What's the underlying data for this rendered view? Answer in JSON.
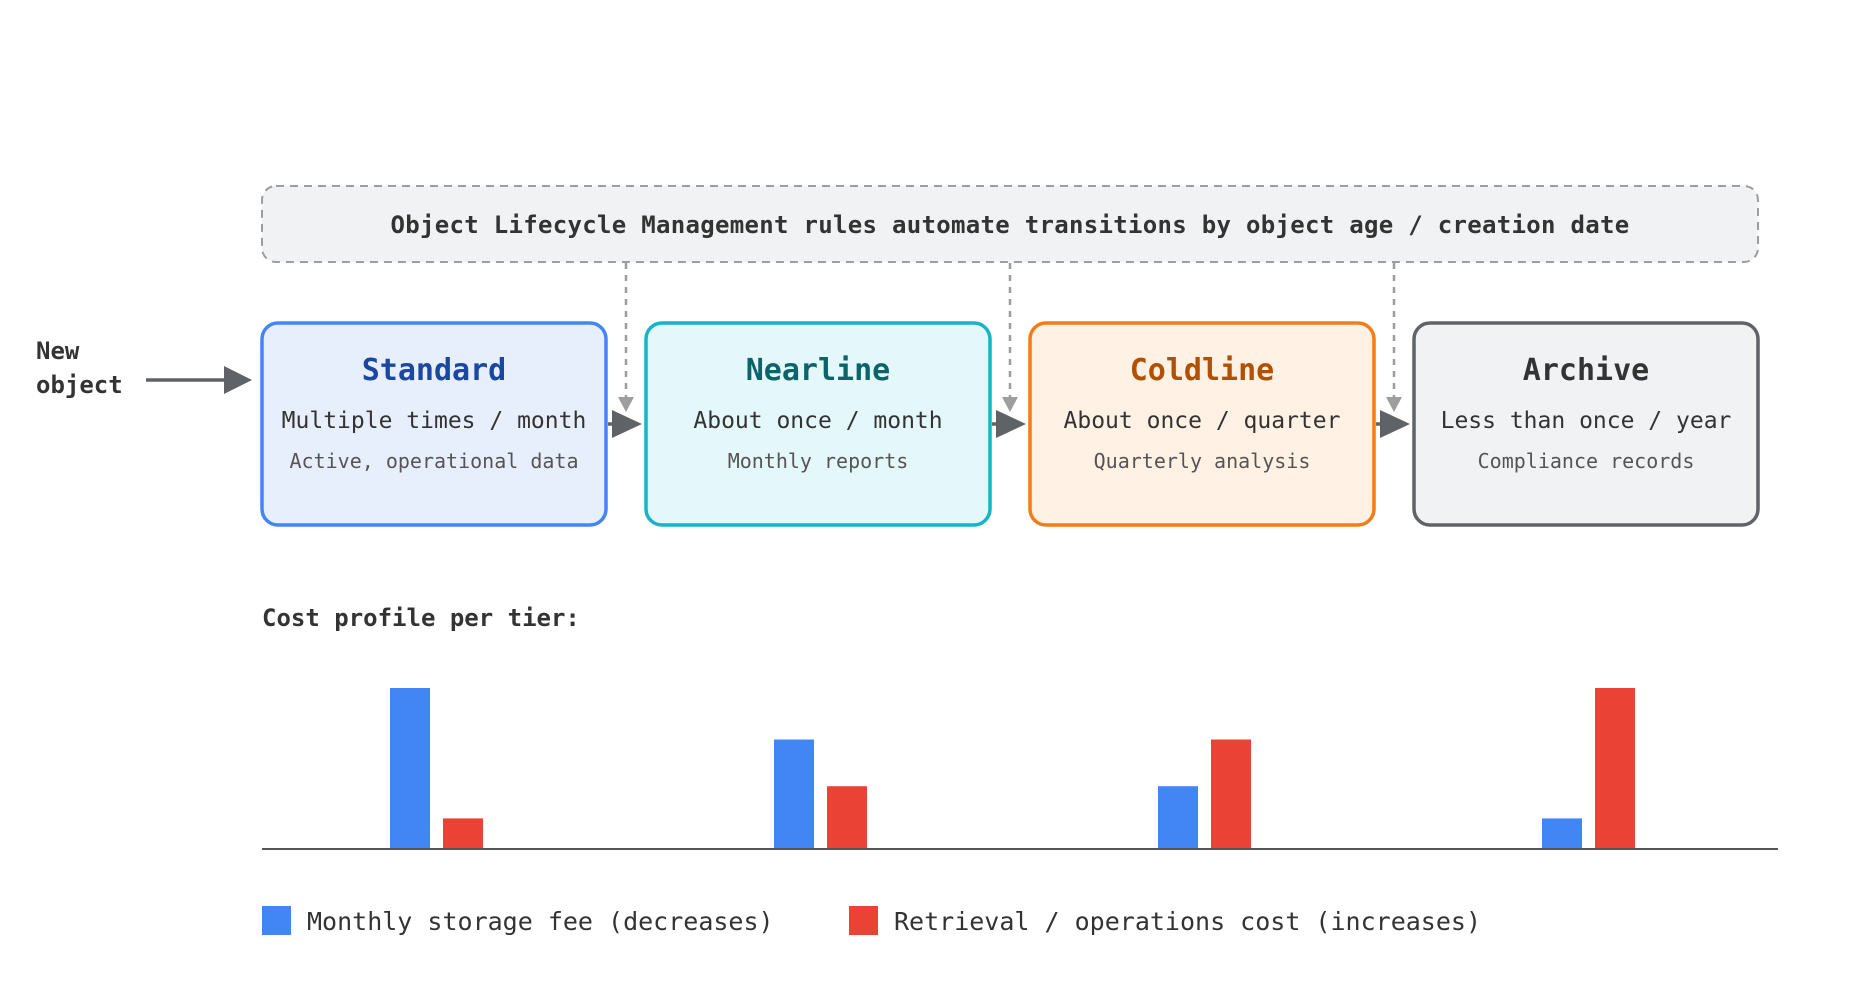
{
  "banner": {
    "text": "Object Lifecycle Management rules automate transitions by object age / creation date"
  },
  "entry": {
    "line1": "New",
    "line2": "object"
  },
  "tiers": [
    {
      "name": "Standard",
      "frequency": "Multiple times / month",
      "example": "Active, operational data",
      "border": "#4285f4",
      "fill": "#e8effc",
      "name_color": "#1a47a0"
    },
    {
      "name": "Nearline",
      "frequency": "About once / month",
      "example": "Monthly reports",
      "border": "#17b3c6",
      "fill": "#e4f7fa",
      "name_color": "#0a6469"
    },
    {
      "name": "Coldline",
      "frequency": "About once / quarter",
      "example": "Quarterly analysis",
      "border": "#f07d1a",
      "fill": "#fff1e3",
      "name_color": "#b34f00"
    },
    {
      "name": "Archive",
      "frequency": "Less than once / year",
      "example": "Compliance records",
      "border": "#5f6368",
      "fill": "#f1f2f3",
      "name_color": "#333333"
    }
  ],
  "cost_profile": {
    "title": "Cost profile per tier:"
  },
  "chart_data": {
    "type": "bar",
    "categories": [
      "Standard",
      "Nearline",
      "Coldline",
      "Archive"
    ],
    "series": [
      {
        "name": "Monthly storage fee (decreases)",
        "color": "#4285f4",
        "values": [
          100,
          68,
          39,
          19
        ]
      },
      {
        "name": "Retrieval / operations cost (increases)",
        "color": "#ea4335",
        "values": [
          19,
          39,
          68,
          100
        ]
      }
    ],
    "ylim": [
      0,
      100
    ]
  },
  "legend": {
    "storage_label": "Monthly storage fee (decreases)",
    "retrieval_label": "Retrieval / operations cost (increases)"
  },
  "colors": {
    "storage": "#4285f4",
    "retrieval": "#ea4335",
    "arrow": "#5f6368",
    "dashed": "#999999"
  }
}
